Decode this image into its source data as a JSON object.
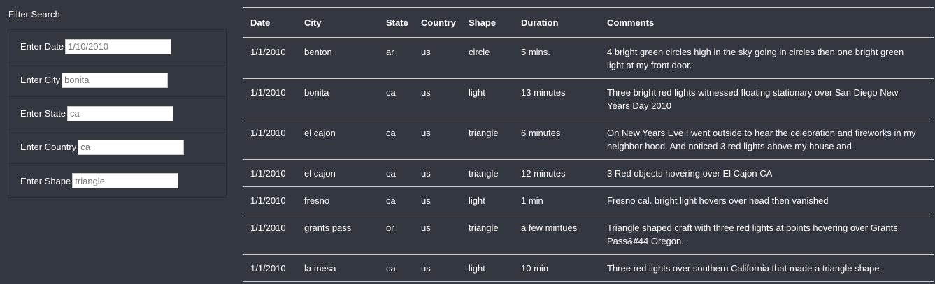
{
  "filter": {
    "title": "Filter Search",
    "fields": [
      {
        "label": "Enter Date",
        "placeholder": "1/10/2010"
      },
      {
        "label": "Enter City",
        "placeholder": "bonita"
      },
      {
        "label": "Enter State",
        "placeholder": "ca"
      },
      {
        "label": "Enter Country",
        "placeholder": "ca"
      },
      {
        "label": "Enter Shape",
        "placeholder": "triangle"
      }
    ]
  },
  "table": {
    "headers": [
      "Date",
      "City",
      "State",
      "Country",
      "Shape",
      "Duration",
      "Comments"
    ],
    "rows": [
      [
        "1/1/2010",
        "benton",
        "ar",
        "us",
        "circle",
        "5 mins.",
        "4 bright green circles high in the sky going in circles then one bright green light at my front door."
      ],
      [
        "1/1/2010",
        "bonita",
        "ca",
        "us",
        "light",
        "13 minutes",
        "Three bright red lights witnessed floating stationary over San Diego New Years Day 2010"
      ],
      [
        "1/1/2010",
        "el cajon",
        "ca",
        "us",
        "triangle",
        "6 minutes",
        "On New Years Eve I went outside to hear the celebration and fireworks in my neighbor hood. And noticed 3 red lights above my house and"
      ],
      [
        "1/1/2010",
        "el cajon",
        "ca",
        "us",
        "triangle",
        "12 minutes",
        "3 Red objects hovering over El Cajon CA"
      ],
      [
        "1/1/2010",
        "fresno",
        "ca",
        "us",
        "light",
        "1 min",
        "Fresno cal. bright light hovers over head then vanished"
      ],
      [
        "1/1/2010",
        "grants pass",
        "or",
        "us",
        "triangle",
        "a few mintues",
        "Triangle shaped craft with three red lights at points hovering over Grants Pass&#44 Oregon."
      ],
      [
        "1/1/2010",
        "la mesa",
        "ca",
        "us",
        "light",
        "10 min",
        "Three red lights over southern California that made a triangle shape"
      ]
    ]
  }
}
